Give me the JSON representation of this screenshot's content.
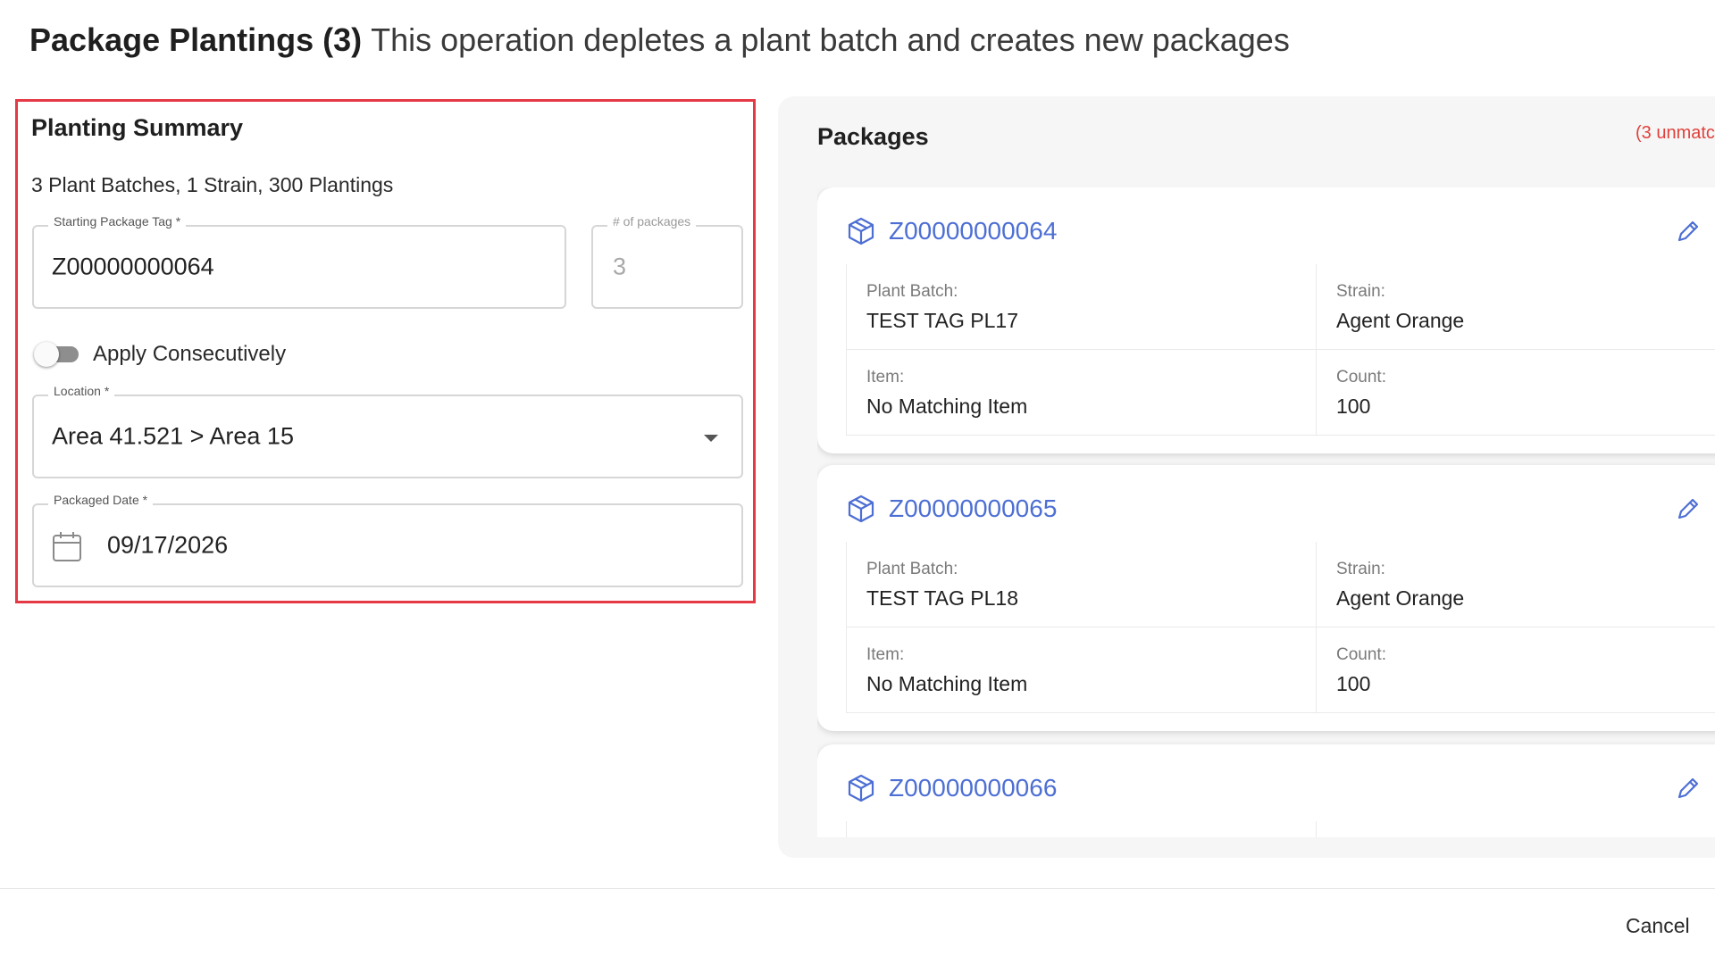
{
  "modal": {
    "title": "Package Plantings (3)",
    "subtitle": "This operation depletes a plant batch and creates new packages"
  },
  "summary": {
    "title": "Planting Summary",
    "stats": "3 Plant Batches, 1 Strain, 300 Plantings",
    "starting_tag": {
      "label": "Starting Package Tag *",
      "value": "Z00000000064"
    },
    "num_packages": {
      "label": "# of packages",
      "value": "3"
    },
    "apply_consecutively": {
      "label": "Apply Consecutively",
      "enabled": false
    },
    "location": {
      "label": "Location *",
      "value": "Area 41.521 > Area 15"
    },
    "packaged_date": {
      "label": "Packaged Date *",
      "value": "09/17/2026"
    }
  },
  "packages": {
    "title": "Packages",
    "unmatched_text": "(3 unmatc",
    "labels": {
      "plant_batch": "Plant Batch:",
      "strain": "Strain:",
      "item": "Item:",
      "count": "Count:"
    },
    "items": [
      {
        "tag": "Z00000000064",
        "plant_batch": "TEST TAG PL17",
        "strain": "Agent Orange",
        "item": "No Matching Item",
        "count": "100"
      },
      {
        "tag": "Z00000000065",
        "plant_batch": "TEST TAG PL18",
        "strain": "Agent Orange",
        "item": "No Matching Item",
        "count": "100"
      },
      {
        "tag": "Z00000000066",
        "plant_batch": "",
        "strain": "",
        "item": "",
        "count": ""
      }
    ]
  },
  "footer": {
    "cancel_label": "Cancel"
  },
  "colors": {
    "accent": "#4d6fd4",
    "highlight_border": "#e53945",
    "warning": "#e0413b"
  }
}
